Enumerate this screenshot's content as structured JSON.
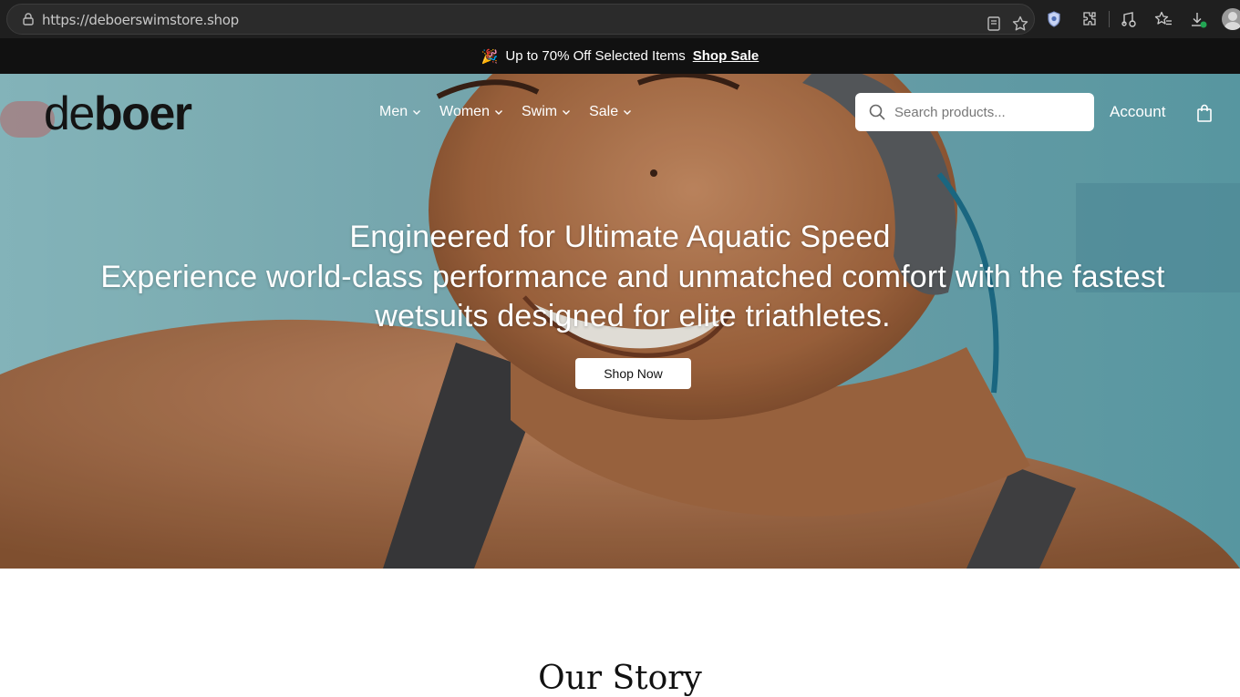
{
  "browser": {
    "url": "https://deboerswimstore.shop"
  },
  "announcement": {
    "emoji": "🎉",
    "text": "Up to 70% Off Selected Items",
    "link": "Shop Sale"
  },
  "header": {
    "logo_light": "de",
    "logo_bold": "boer",
    "nav": [
      {
        "label": "Men"
      },
      {
        "label": "Women"
      },
      {
        "label": "Swim"
      },
      {
        "label": "Sale"
      }
    ],
    "search_placeholder": "Search products...",
    "account_label": "Account"
  },
  "hero": {
    "title": "Engineered for Ultimate Aquatic Speed",
    "subtitle": "Experience world-class performance and unmatched comfort with the fastest wetsuits designed for elite triathletes.",
    "cta": "Shop Now"
  },
  "story": {
    "title": "Our Story"
  },
  "colors": {
    "announcement_bg": "#111111",
    "hero_overlay": "#7fb6bd",
    "text_dark": "#141414"
  }
}
